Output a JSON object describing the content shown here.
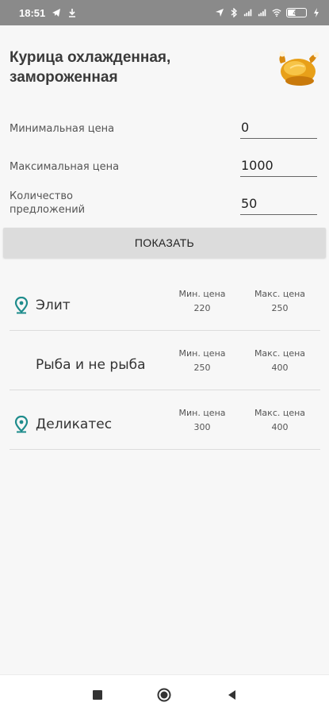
{
  "status_bar": {
    "time": "18:51",
    "battery": "40"
  },
  "header": {
    "title": "Курица охлажденная, замороженная",
    "image_icon": "roast-chicken-icon"
  },
  "filters": {
    "min_price": {
      "label": "Минимальная цена",
      "value": "0"
    },
    "max_price": {
      "label": "Максимальная цена",
      "value": "1000"
    },
    "offers": {
      "label": "Количество предложений",
      "value": "50"
    }
  },
  "show_button_label": "ПОКАЗАТЬ",
  "shops": [
    {
      "name": "Элит",
      "has_pin": true,
      "min_label": "Мин. цена",
      "min_value": "220",
      "max_label": "Макс. цена",
      "max_value": "250"
    },
    {
      "name": "Рыба и не рыба",
      "has_pin": false,
      "min_label": "Мин. цена",
      "min_value": "250",
      "max_label": "Макс. цена",
      "max_value": "400"
    },
    {
      "name": "Деликатес",
      "has_pin": true,
      "min_label": "Мин. цена",
      "min_value": "300",
      "max_label": "Макс. цена",
      "max_value": "400"
    }
  ],
  "colors": {
    "pin": "#1e8c8c",
    "status_bar": "#8a8a8a",
    "button": "#dcdcdc"
  },
  "nav": {
    "icons": [
      "square-recents-icon",
      "circle-home-icon",
      "triangle-back-icon"
    ]
  }
}
